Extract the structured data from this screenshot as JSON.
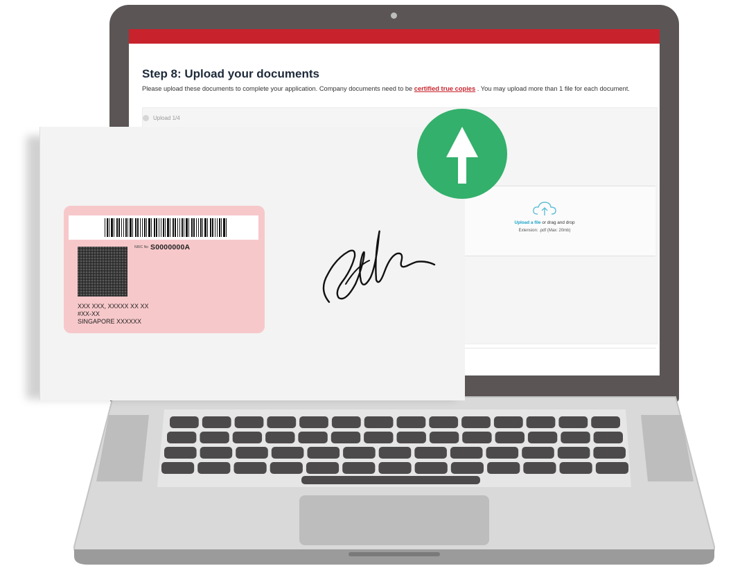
{
  "screen": {
    "step_title": "Step 8: Upload your documents",
    "description_before": "Please upload these documents to complete your application. Company documents need to be ",
    "description_link": "certified true copies",
    "description_after": " . You may upload more than 1 file for each document.",
    "upload_index": "Upload 1/4",
    "dropzone": {
      "icon": "cloud-upload-icon",
      "link_text": "Upload a file",
      "text": " or drag and drop",
      "extension_text": "Extension: .pdf (Max: 20mb)"
    }
  },
  "document": {
    "nric_label": "NRIC No",
    "nric_value": "S0000000A",
    "address_lines": [
      "XXX XXX, XXXXX XX XX",
      "#XX-XX",
      "SINGAPORE XXXXXX"
    ]
  },
  "badge": {
    "icon": "arrow-up-icon"
  },
  "colors": {
    "brand_red": "#c8232c",
    "badge_green": "#33b06b",
    "card_pink": "#f7c8ca",
    "laptop_dark": "#5b5556",
    "laptop_silver": "#d9d9d9"
  }
}
